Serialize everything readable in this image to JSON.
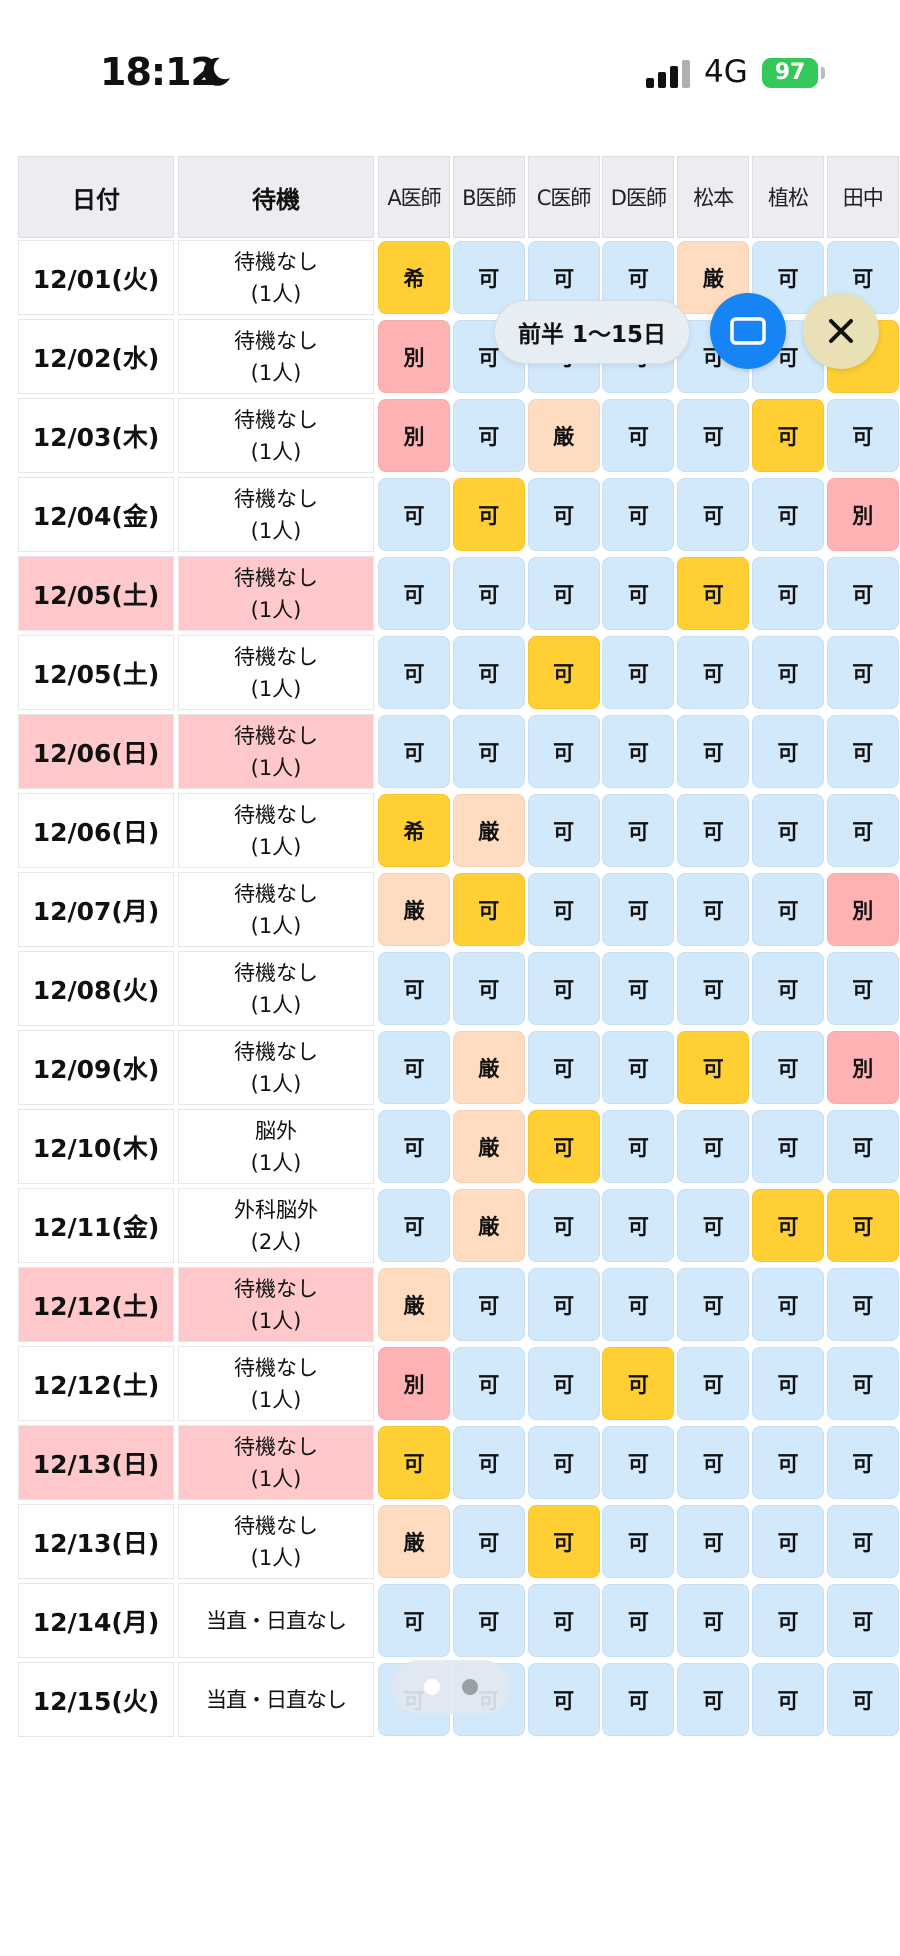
{
  "status_bar": {
    "time": "18:12",
    "network": "4G",
    "battery": "97"
  },
  "colors": {
    "ka": "#d2e8fb",
    "selected": "#ffcf33",
    "strict": "#ffdcc0",
    "separate": "#ffb2b4",
    "weekend": "#ffc9cc"
  },
  "table": {
    "headers": {
      "date": "日付",
      "wait": "待機",
      "doctors": [
        "A医師",
        "B医師",
        "C医師",
        "D医師",
        "松本",
        "植松",
        "田中"
      ]
    },
    "rows": [
      {
        "date": "12/01(火)",
        "wait": [
          "待機なし",
          "(1人)"
        ],
        "weekend": false,
        "cells": [
          {
            "t": "希",
            "s": "sel"
          },
          {
            "t": "可",
            "s": "ka"
          },
          {
            "t": "可",
            "s": "ka"
          },
          {
            "t": "可",
            "s": "ka"
          },
          {
            "t": "厳",
            "s": "gen"
          },
          {
            "t": "可",
            "s": "ka"
          },
          {
            "t": "可",
            "s": "ka"
          }
        ]
      },
      {
        "date": "12/02(水)",
        "wait": [
          "待機なし",
          "(1人)"
        ],
        "weekend": false,
        "cells": [
          {
            "t": "別",
            "s": "betsu"
          },
          {
            "t": "可",
            "s": "ka"
          },
          {
            "t": "可",
            "s": "ka"
          },
          {
            "t": "可",
            "s": "ka"
          },
          {
            "t": "可",
            "s": "ka"
          },
          {
            "t": "可",
            "s": "ka"
          },
          {
            "t": "",
            "s": "sel"
          }
        ]
      },
      {
        "date": "12/03(木)",
        "wait": [
          "待機なし",
          "(1人)"
        ],
        "weekend": false,
        "cells": [
          {
            "t": "別",
            "s": "betsu"
          },
          {
            "t": "可",
            "s": "ka"
          },
          {
            "t": "厳",
            "s": "gen"
          },
          {
            "t": "可",
            "s": "ka"
          },
          {
            "t": "可",
            "s": "ka"
          },
          {
            "t": "可",
            "s": "sel"
          },
          {
            "t": "可",
            "s": "ka"
          }
        ]
      },
      {
        "date": "12/04(金)",
        "wait": [
          "待機なし",
          "(1人)"
        ],
        "weekend": false,
        "cells": [
          {
            "t": "可",
            "s": "ka"
          },
          {
            "t": "可",
            "s": "sel"
          },
          {
            "t": "可",
            "s": "ka"
          },
          {
            "t": "可",
            "s": "ka"
          },
          {
            "t": "可",
            "s": "ka"
          },
          {
            "t": "可",
            "s": "ka"
          },
          {
            "t": "別",
            "s": "betsu"
          }
        ]
      },
      {
        "date": "12/05(土)",
        "wait": [
          "待機なし",
          "(1人)"
        ],
        "weekend": true,
        "cells": [
          {
            "t": "可",
            "s": "ka"
          },
          {
            "t": "可",
            "s": "ka"
          },
          {
            "t": "可",
            "s": "ka"
          },
          {
            "t": "可",
            "s": "ka"
          },
          {
            "t": "可",
            "s": "sel"
          },
          {
            "t": "可",
            "s": "ka"
          },
          {
            "t": "可",
            "s": "ka"
          }
        ]
      },
      {
        "date": "12/05(土)",
        "wait": [
          "待機なし",
          "(1人)"
        ],
        "weekend": false,
        "cells": [
          {
            "t": "可",
            "s": "ka"
          },
          {
            "t": "可",
            "s": "ka"
          },
          {
            "t": "可",
            "s": "sel"
          },
          {
            "t": "可",
            "s": "ka"
          },
          {
            "t": "可",
            "s": "ka"
          },
          {
            "t": "可",
            "s": "ka"
          },
          {
            "t": "可",
            "s": "ka"
          }
        ]
      },
      {
        "date": "12/06(日)",
        "wait": [
          "待機なし",
          "(1人)"
        ],
        "weekend": true,
        "cells": [
          {
            "t": "可",
            "s": "ka"
          },
          {
            "t": "可",
            "s": "ka"
          },
          {
            "t": "可",
            "s": "ka"
          },
          {
            "t": "可",
            "s": "ka"
          },
          {
            "t": "可",
            "s": "ka"
          },
          {
            "t": "可",
            "s": "ka"
          },
          {
            "t": "可",
            "s": "ka"
          }
        ]
      },
      {
        "date": "12/06(日)",
        "wait": [
          "待機なし",
          "(1人)"
        ],
        "weekend": false,
        "cells": [
          {
            "t": "希",
            "s": "sel"
          },
          {
            "t": "厳",
            "s": "gen"
          },
          {
            "t": "可",
            "s": "ka"
          },
          {
            "t": "可",
            "s": "ka"
          },
          {
            "t": "可",
            "s": "ka"
          },
          {
            "t": "可",
            "s": "ka"
          },
          {
            "t": "可",
            "s": "ka"
          }
        ]
      },
      {
        "date": "12/07(月)",
        "wait": [
          "待機なし",
          "(1人)"
        ],
        "weekend": false,
        "cells": [
          {
            "t": "厳",
            "s": "gen"
          },
          {
            "t": "可",
            "s": "sel"
          },
          {
            "t": "可",
            "s": "ka"
          },
          {
            "t": "可",
            "s": "ka"
          },
          {
            "t": "可",
            "s": "ka"
          },
          {
            "t": "可",
            "s": "ka"
          },
          {
            "t": "別",
            "s": "betsu"
          }
        ]
      },
      {
        "date": "12/08(火)",
        "wait": [
          "待機なし",
          "(1人)"
        ],
        "weekend": false,
        "cells": [
          {
            "t": "可",
            "s": "ka"
          },
          {
            "t": "可",
            "s": "ka"
          },
          {
            "t": "可",
            "s": "ka"
          },
          {
            "t": "可",
            "s": "ka"
          },
          {
            "t": "可",
            "s": "ka"
          },
          {
            "t": "可",
            "s": "ka"
          },
          {
            "t": "可",
            "s": "ka"
          }
        ]
      },
      {
        "date": "12/09(水)",
        "wait": [
          "待機なし",
          "(1人)"
        ],
        "weekend": false,
        "cells": [
          {
            "t": "可",
            "s": "ka"
          },
          {
            "t": "厳",
            "s": "gen"
          },
          {
            "t": "可",
            "s": "ka"
          },
          {
            "t": "可",
            "s": "ka"
          },
          {
            "t": "可",
            "s": "sel"
          },
          {
            "t": "可",
            "s": "ka"
          },
          {
            "t": "別",
            "s": "betsu"
          }
        ]
      },
      {
        "date": "12/10(木)",
        "wait": [
          "脳外",
          "(1人)"
        ],
        "weekend": false,
        "cells": [
          {
            "t": "可",
            "s": "ka"
          },
          {
            "t": "厳",
            "s": "gen"
          },
          {
            "t": "可",
            "s": "sel"
          },
          {
            "t": "可",
            "s": "ka"
          },
          {
            "t": "可",
            "s": "ka"
          },
          {
            "t": "可",
            "s": "ka"
          },
          {
            "t": "可",
            "s": "ka"
          }
        ]
      },
      {
        "date": "12/11(金)",
        "wait": [
          "外科脳外",
          "(2人)"
        ],
        "weekend": false,
        "cells": [
          {
            "t": "可",
            "s": "ka"
          },
          {
            "t": "厳",
            "s": "gen"
          },
          {
            "t": "可",
            "s": "ka"
          },
          {
            "t": "可",
            "s": "ka"
          },
          {
            "t": "可",
            "s": "ka"
          },
          {
            "t": "可",
            "s": "sel"
          },
          {
            "t": "可",
            "s": "sel"
          }
        ]
      },
      {
        "date": "12/12(土)",
        "wait": [
          "待機なし",
          "(1人)"
        ],
        "weekend": true,
        "cells": [
          {
            "t": "厳",
            "s": "gen"
          },
          {
            "t": "可",
            "s": "ka"
          },
          {
            "t": "可",
            "s": "ka"
          },
          {
            "t": "可",
            "s": "ka"
          },
          {
            "t": "可",
            "s": "ka"
          },
          {
            "t": "可",
            "s": "ka"
          },
          {
            "t": "可",
            "s": "ka"
          }
        ]
      },
      {
        "date": "12/12(土)",
        "wait": [
          "待機なし",
          "(1人)"
        ],
        "weekend": false,
        "cells": [
          {
            "t": "別",
            "s": "betsu"
          },
          {
            "t": "可",
            "s": "ka"
          },
          {
            "t": "可",
            "s": "ka"
          },
          {
            "t": "可",
            "s": "sel"
          },
          {
            "t": "可",
            "s": "ka"
          },
          {
            "t": "可",
            "s": "ka"
          },
          {
            "t": "可",
            "s": "ka"
          }
        ]
      },
      {
        "date": "12/13(日)",
        "wait": [
          "待機なし",
          "(1人)"
        ],
        "weekend": true,
        "cells": [
          {
            "t": "可",
            "s": "sel"
          },
          {
            "t": "可",
            "s": "ka"
          },
          {
            "t": "可",
            "s": "ka"
          },
          {
            "t": "可",
            "s": "ka"
          },
          {
            "t": "可",
            "s": "ka"
          },
          {
            "t": "可",
            "s": "ka"
          },
          {
            "t": "可",
            "s": "ka"
          }
        ]
      },
      {
        "date": "12/13(日)",
        "wait": [
          "待機なし",
          "(1人)"
        ],
        "weekend": false,
        "cells": [
          {
            "t": "厳",
            "s": "gen"
          },
          {
            "t": "可",
            "s": "ka"
          },
          {
            "t": "可",
            "s": "sel"
          },
          {
            "t": "可",
            "s": "ka"
          },
          {
            "t": "可",
            "s": "ka"
          },
          {
            "t": "可",
            "s": "ka"
          },
          {
            "t": "可",
            "s": "ka"
          }
        ]
      },
      {
        "date": "12/14(月)",
        "wait": [
          "当直・日直なし"
        ],
        "weekend": false,
        "cells": [
          {
            "t": "可",
            "s": "ka"
          },
          {
            "t": "可",
            "s": "ka"
          },
          {
            "t": "可",
            "s": "ka"
          },
          {
            "t": "可",
            "s": "ka"
          },
          {
            "t": "可",
            "s": "ka"
          },
          {
            "t": "可",
            "s": "ka"
          },
          {
            "t": "可",
            "s": "ka"
          }
        ]
      },
      {
        "date": "12/15(火)",
        "wait": [
          "当直・日直なし"
        ],
        "weekend": false,
        "cells": [
          {
            "t": "可",
            "s": "ka"
          },
          {
            "t": "可",
            "s": "ka"
          },
          {
            "t": "可",
            "s": "ka"
          },
          {
            "t": "可",
            "s": "ka"
          },
          {
            "t": "可",
            "s": "ka"
          },
          {
            "t": "可",
            "s": "ka"
          },
          {
            "t": "可",
            "s": "ka"
          }
        ]
      }
    ]
  },
  "overlay": {
    "period_label": "前半 1〜15日",
    "screen_icon": "screen-mirror-icon",
    "close_icon": "close-icon",
    "pages": 2,
    "current_page": 1
  }
}
